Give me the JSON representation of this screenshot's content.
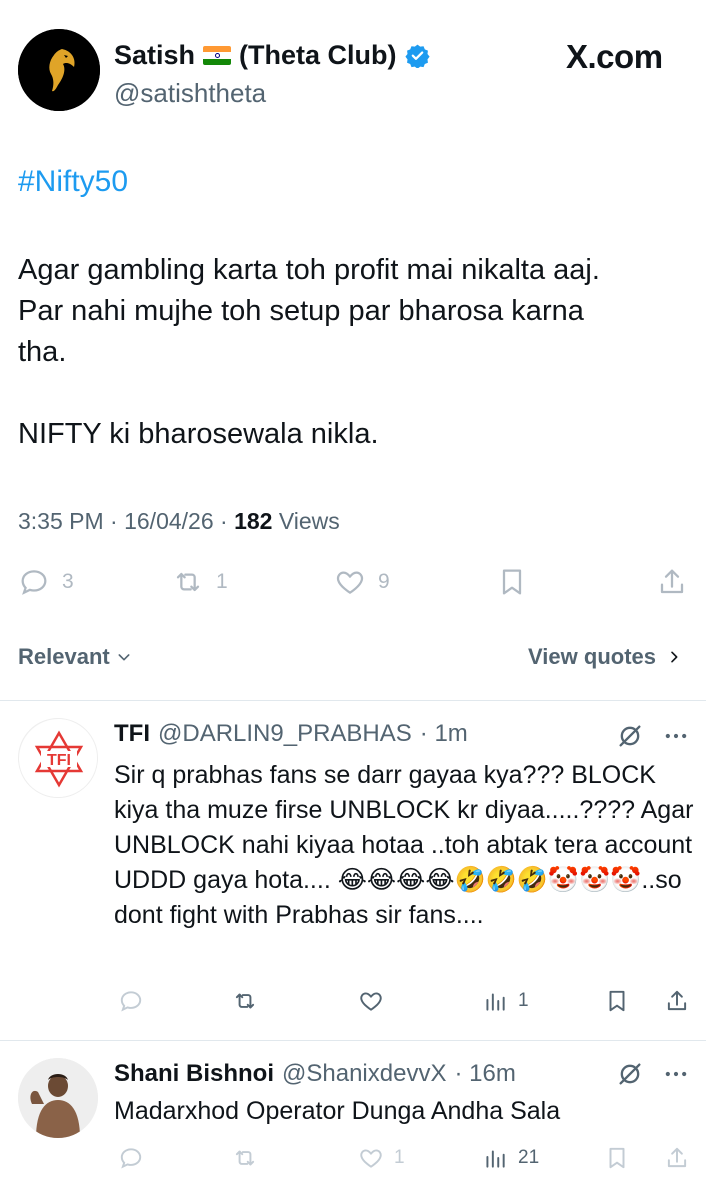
{
  "tweet": {
    "author_name": "Satish",
    "author_team": "(Theta Club)",
    "handle": "@satishtheta",
    "site": "X.com",
    "hashtag": "#Nifty50",
    "text_lines": "Agar gambling karta toh profit mai nikalta aaj.\nPar nahi mujhe toh setup par bharosa karna\ntha.\n\nNIFTY ki bharosewala nikla.",
    "time_date": "3:35 PM · 16/04/26 · ",
    "views_count": "182",
    "views_label": "Views",
    "actions": {
      "replies": "3",
      "reposts": "1",
      "likes": "9"
    }
  },
  "filters": {
    "sort_label": "Relevant",
    "view_quotes_label": "View quotes"
  },
  "replies": [
    {
      "name": "TFI",
      "handle": "@DARLIN9_PRABHAS",
      "time": "· 1m",
      "avatar_text": "TFI",
      "text": "Sir q prabhas fans se darr gayaa kya??? BLOCK kiya tha muze firse UNBLOCK kr diyaa.....???? Agar UNBLOCK nahi kiyaa hotaa ..toh abtak tera account UDDD gaya hota.... 😂😂😂😂🤣🤣🤣🤡🤡🤡..so dont fight with Prabhas sir fans....",
      "views": "1"
    },
    {
      "name": "Shani Bishnoi",
      "handle": "@ShanixdevvX",
      "time": "· 16m",
      "text": "Madarxhod Operator  Dunga Andha Sala",
      "likes": "1",
      "views": "21"
    }
  ],
  "colors": {
    "accent": "#1d9bf0",
    "text": "#0f1419",
    "muted": "#536471",
    "faded_icon": "#b0b9c2",
    "divider": "#e1e8ed"
  }
}
